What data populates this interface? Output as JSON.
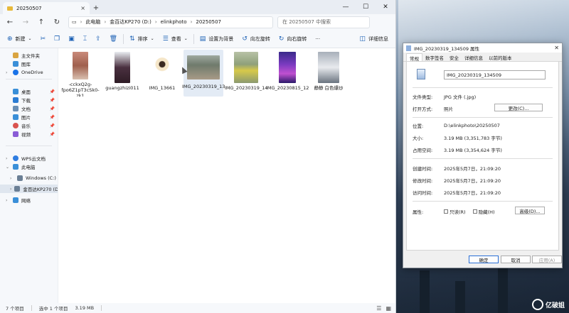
{
  "explorer": {
    "tab_title": "20250507",
    "tab_close": "×",
    "tab_add": "+",
    "win_min": "—",
    "win_max": "☐",
    "win_close": "✕",
    "breadcrumb": [
      "此电脑",
      "金百达KP270 (D:)",
      "elinkphoto",
      "20250507"
    ],
    "search_placeholder": "在 20250507 中搜索",
    "toolbar": {
      "new_label": "新建",
      "sort_label": "排序",
      "view_label": "查看",
      "set_bg_label": "设置为背景",
      "rotate_left_label": "向左旋转",
      "rotate_right_label": "向右旋转",
      "more_label": "···",
      "details_label": "详细信息"
    },
    "sidebar": {
      "items": [
        {
          "label": "主文件夹",
          "color": "#d9a441"
        },
        {
          "label": "图库",
          "color": "#3a8fd8"
        },
        {
          "label": "OneDrive",
          "color": "#1a73e8"
        },
        {
          "label": "桌面",
          "color": "#3a8fd8"
        },
        {
          "label": "下载",
          "color": "#2b7cd3"
        },
        {
          "label": "文档",
          "color": "#6a8fb5"
        },
        {
          "label": "图片",
          "color": "#3a8fd8"
        },
        {
          "label": "音乐",
          "color": "#d9534f"
        },
        {
          "label": "视频",
          "color": "#8a5cd6"
        },
        {
          "label": "WPS云文档",
          "color": "#2f7de1"
        },
        {
          "label": "此电脑",
          "color": "#3a8fd8"
        },
        {
          "label": "Windows (C:)",
          "color": "#6b7f95"
        },
        {
          "label": "金百达KP270 (D:)",
          "color": "#6b7f95"
        },
        {
          "label": "网络",
          "color": "#3a8fd8"
        }
      ]
    },
    "files": [
      {
        "name": "-cckxQ2g-fpo6Z1pT3cSk0-zk1"
      },
      {
        "name": "guangzhizi011"
      },
      {
        "name": "IMG_13661"
      },
      {
        "name": "IMG_20230319_134509"
      },
      {
        "name": "IMG_20230319_143909"
      },
      {
        "name": "IMG_20230815_124449"
      },
      {
        "name": "静静 白色爆炒"
      }
    ],
    "status": {
      "count": "7 个项目",
      "selected": "选中 1 个项目",
      "size": "3.19 MB"
    }
  },
  "props": {
    "title": "IMG_20230319_134509 属性",
    "close": "✕",
    "tabs": [
      "常规",
      "数字签名",
      "安全",
      "详细信息",
      "以前的版本"
    ],
    "filename": "IMG_20230319_134509",
    "rows": {
      "file_type_k": "文件类型:",
      "file_type_v": "JPG 文件 (.jpg)",
      "open_with_k": "打开方式:",
      "open_with_v": "照片",
      "change_btn": "更改(C)...",
      "location_k": "位置:",
      "location_v": "D:\\elinkphoto\\20250507",
      "size_k": "大小:",
      "size_v": "3.19 MB (3,351,783 字节)",
      "disk_k": "占用空间:",
      "disk_v": "3.19 MB (3,354,624 字节)",
      "created_k": "创建时间:",
      "created_v": "2025年5月7日，21:09:20",
      "modified_k": "修改时间:",
      "modified_v": "2025年5月7日，21:09:20",
      "accessed_k": "访问时间:",
      "accessed_v": "2025年5月7日，21:09:20",
      "attr_k": "属性:",
      "readonly": "只读(R)",
      "hidden": "隐藏(H)",
      "advanced_btn": "高级(D)..."
    },
    "ok": "确定",
    "cancel": "取消",
    "apply": "应用(A)"
  },
  "watermark": "亿破姐"
}
